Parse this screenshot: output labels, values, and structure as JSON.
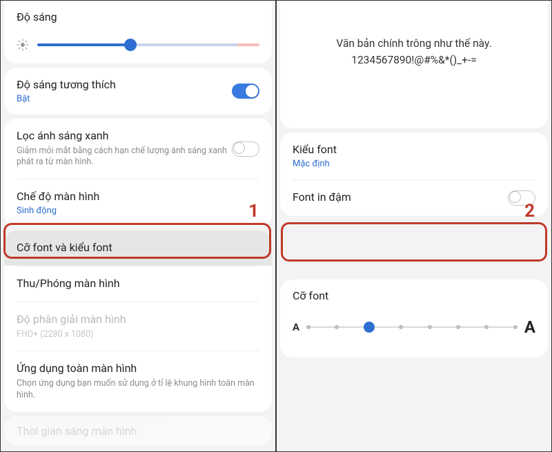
{
  "left": {
    "brightness_label": "Độ sáng",
    "adaptive": {
      "title": "Độ sáng tương thích",
      "status": "Bật"
    },
    "bluelight": {
      "title": "Lọc ánh sáng xanh",
      "desc": "Giảm mỏi mắt bằng cách hạn chế lượng ánh sáng xanh phát ra từ màn hình."
    },
    "screenmode": {
      "title": "Chế độ màn hình",
      "value": "Sinh động"
    },
    "fontrow": {
      "title": "Cỡ font và kiểu font"
    },
    "zoom": {
      "title": "Thu/Phóng màn hình"
    },
    "resolution": {
      "title": "Độ phân giải màn hình",
      "value": "FHD+ (2280 x 1080)"
    },
    "fullscreen": {
      "title": "Ứng dụng toàn màn hình",
      "desc": "Chọn ứng dụng bạn muốn sử dụng ở tỉ lệ khung hình toàn màn hình."
    },
    "cutoff": "Thời gian sáng màn hình"
  },
  "right": {
    "preview_line1": "Văn bản chính trông như thế này.",
    "preview_line2": "1234567890!@#%&*()_+-=",
    "fontstyle": {
      "title": "Kiểu font",
      "value": "Mặc định"
    },
    "bold": {
      "title": "Font in đậm"
    },
    "fontsize_label": "Cỡ font"
  },
  "steps": {
    "one": "1",
    "two": "2"
  }
}
